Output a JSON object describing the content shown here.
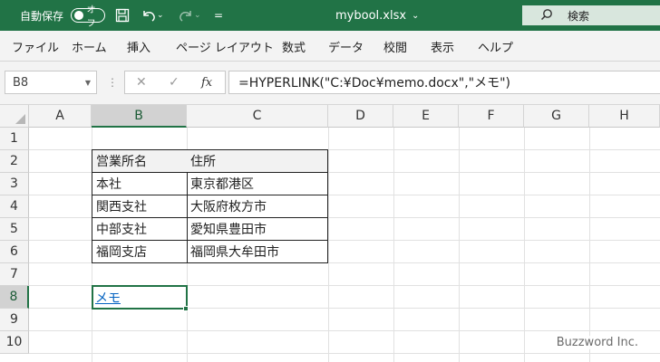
{
  "titlebar": {
    "autosave_label": "自動保存",
    "autosave_state": "オフ",
    "qat_more": "=",
    "filename": "mybool.xlsx",
    "filename_dropdown": "⌄",
    "search_placeholder": "検索"
  },
  "ribbon_tabs": [
    {
      "label": "ファイル"
    },
    {
      "label": "ホーム"
    },
    {
      "label": "挿入"
    },
    {
      "label": "ページ レイアウト"
    },
    {
      "label": "数式"
    },
    {
      "label": "データ"
    },
    {
      "label": "校閲"
    },
    {
      "label": "表示"
    },
    {
      "label": "ヘルプ"
    }
  ],
  "formula_bar": {
    "name_box": "B8",
    "fx_label": "fx",
    "formula": "=HYPERLINK(\"C:¥Doc¥memo.docx\",\"メモ\")"
  },
  "columns": [
    "A",
    "B",
    "C",
    "D",
    "E",
    "F",
    "G",
    "H"
  ],
  "rows": [
    "1",
    "2",
    "3",
    "4",
    "5",
    "6",
    "7",
    "8",
    "9",
    "10"
  ],
  "selected_column": "B",
  "selected_row": "8",
  "table": {
    "header": [
      "営業所名",
      "住所"
    ],
    "rows": [
      [
        "本社",
        "東京都港区"
      ],
      [
        "関西支社",
        "大阪府枚方市"
      ],
      [
        "中部支社",
        "愛知県豊田市"
      ],
      [
        "福岡支店",
        "福岡県大牟田市"
      ]
    ]
  },
  "hyperlink_cell": {
    "address": "B8",
    "text": "メモ",
    "color": "#0563c1"
  },
  "accent_color": "#217346",
  "watermark": "Buzzword Inc."
}
